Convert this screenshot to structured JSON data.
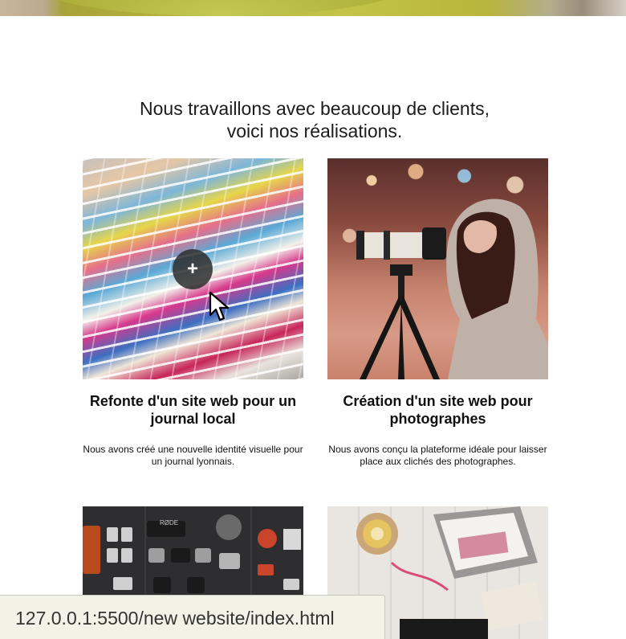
{
  "section": {
    "title_line1": "Nous travaillons avec beaucoup de clients,",
    "title_line2": "voici nos réalisations."
  },
  "portfolio": [
    {
      "title_line1": "Refonte d'un site web pour un",
      "title_line2": "journal local",
      "desc_line1": "Nous avons créé une nouvelle identité visuelle pour",
      "desc_line2": "un journal lyonnais.",
      "image_icon": "magazines-image",
      "hover_glyph": "+"
    },
    {
      "title_line1": "Création d'un site web pour",
      "title_line2": "photographes",
      "desc_line1": "Nous avons conçu la plateforme idéale pour laisser",
      "desc_line2": "place aux clichés des photographes.",
      "image_icon": "photographer-image"
    },
    {
      "image_icon": "camera-gear-image"
    },
    {
      "image_icon": "desk-laptop-image"
    }
  ],
  "status_bar": {
    "url": "127.0.0.1:5500/new website/index.html"
  },
  "colors": {
    "overlay": "#2d2d2d",
    "status_bg": "#f2f2e6",
    "text": "#111111"
  }
}
